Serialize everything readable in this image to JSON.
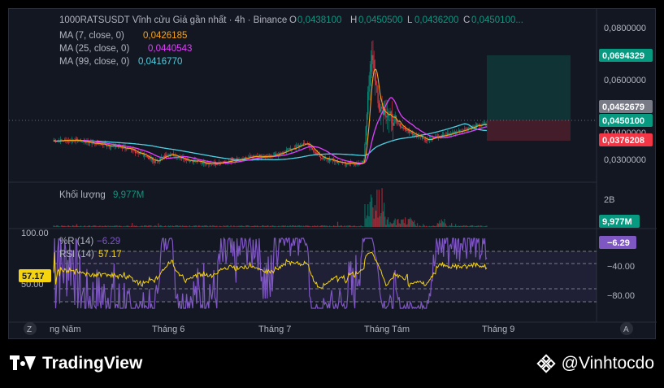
{
  "header": {
    "symbol": "1000RATSUSDT Vĩnh cửu Giá gần nhất · 4h · Binance",
    "ohlc": [
      {
        "k": "O",
        "v": "0,0438100"
      },
      {
        "k": "H",
        "v": "0,0450500"
      },
      {
        "k": "L",
        "v": "0,0436200"
      },
      {
        "k": "C",
        "v": "0,0450100..."
      }
    ]
  },
  "indicators": [
    {
      "label": "MA (7, close, 0)",
      "value": "0,0426185",
      "color": "#f7a21b"
    },
    {
      "label": "MA (25, close, 0)",
      "value": "0,0440543",
      "color": "#e040fb"
    },
    {
      "label": "MA (99, close, 0)",
      "value": "0,0416770",
      "color": "#4dd0e1"
    }
  ],
  "price_axis": {
    "ticks": [
      "0,0800000",
      "0,0600000",
      "0,0400000",
      "0,0300000"
    ],
    "labels": [
      {
        "text": "0,0694329",
        "bg": "#089981"
      },
      {
        "text": "0,0452679",
        "bg": "#787b86"
      },
      {
        "text": "0,0450100",
        "bg": "#089981"
      },
      {
        "text": "0,0376208",
        "bg": "#f23645"
      }
    ]
  },
  "volume": {
    "label": "Khối lượng",
    "value": "9,977M",
    "axis_top": "2B",
    "axis_label": "9,977M"
  },
  "oscillator": {
    "wr_label": "%R (14)",
    "wr_value": "−6.29",
    "rsi_label": "RSI (14)",
    "rsi_value": "57.17",
    "left_top": "100.00",
    "left_mid": "50.00",
    "left_badge": "57.17",
    "axis_ticks": [
      "−40.00",
      "−80.00"
    ],
    "axis_badge": "−6.29"
  },
  "time_axis": {
    "labels": [
      "ng Năm",
      "Tháng 6",
      "Tháng 7",
      "Tháng Tám",
      "Tháng 9"
    ],
    "left_button": "Z",
    "right_button": "A"
  },
  "footer": {
    "brand": "TradingView",
    "author": "@Vinhtocdo"
  },
  "chart_data": {
    "type": "candlestick",
    "interval": "4h",
    "ohlc_close_series_approx": {
      "x": [
        "Tháng 5",
        "Tháng 6",
        "Tháng 7",
        "Tháng Tám",
        "Tháng 9"
      ],
      "close": [
        0.0395,
        0.0325,
        0.0345,
        0.0525,
        0.045
      ]
    },
    "ylim": [
      0.026,
      0.082
    ],
    "long_position": {
      "target": 0.0694329,
      "entry": 0.0452679,
      "stop": 0.0376208
    },
    "last_price": 0.04501
  }
}
